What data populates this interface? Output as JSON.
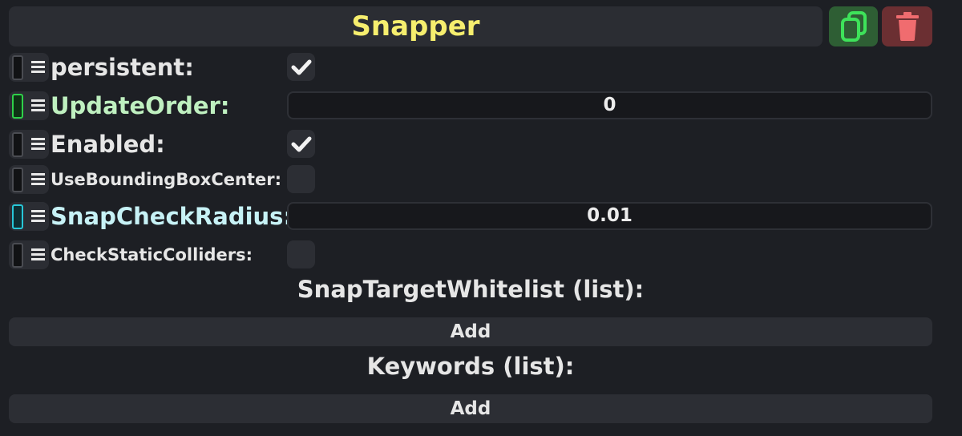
{
  "header": {
    "title": "Snapper",
    "duplicate_icon": "copy-icon",
    "delete_icon": "trash-icon",
    "title_color": "#f6ee6e",
    "duplicate_bg": "#2e5e34",
    "delete_bg": "#6b2f32"
  },
  "fields": [
    {
      "label": "persistent:",
      "type": "checkbox",
      "checked": true
    },
    {
      "label": "UpdateOrder:",
      "type": "number",
      "value": "0",
      "accent": "green"
    },
    {
      "label": "Enabled:",
      "type": "checkbox",
      "checked": true
    },
    {
      "label": "UseBoundingBoxCenter:",
      "type": "checkbox",
      "checked": false
    },
    {
      "label": "SnapCheckRadius:",
      "type": "number",
      "value": "0.01",
      "accent": "cyan"
    },
    {
      "label": "CheckStaticColliders:",
      "type": "checkbox",
      "checked": false
    }
  ],
  "lists": [
    {
      "title": "SnapTargetWhitelist (list):",
      "add_label": "Add"
    },
    {
      "title": "Keywords (list):",
      "add_label": "Add"
    }
  ]
}
